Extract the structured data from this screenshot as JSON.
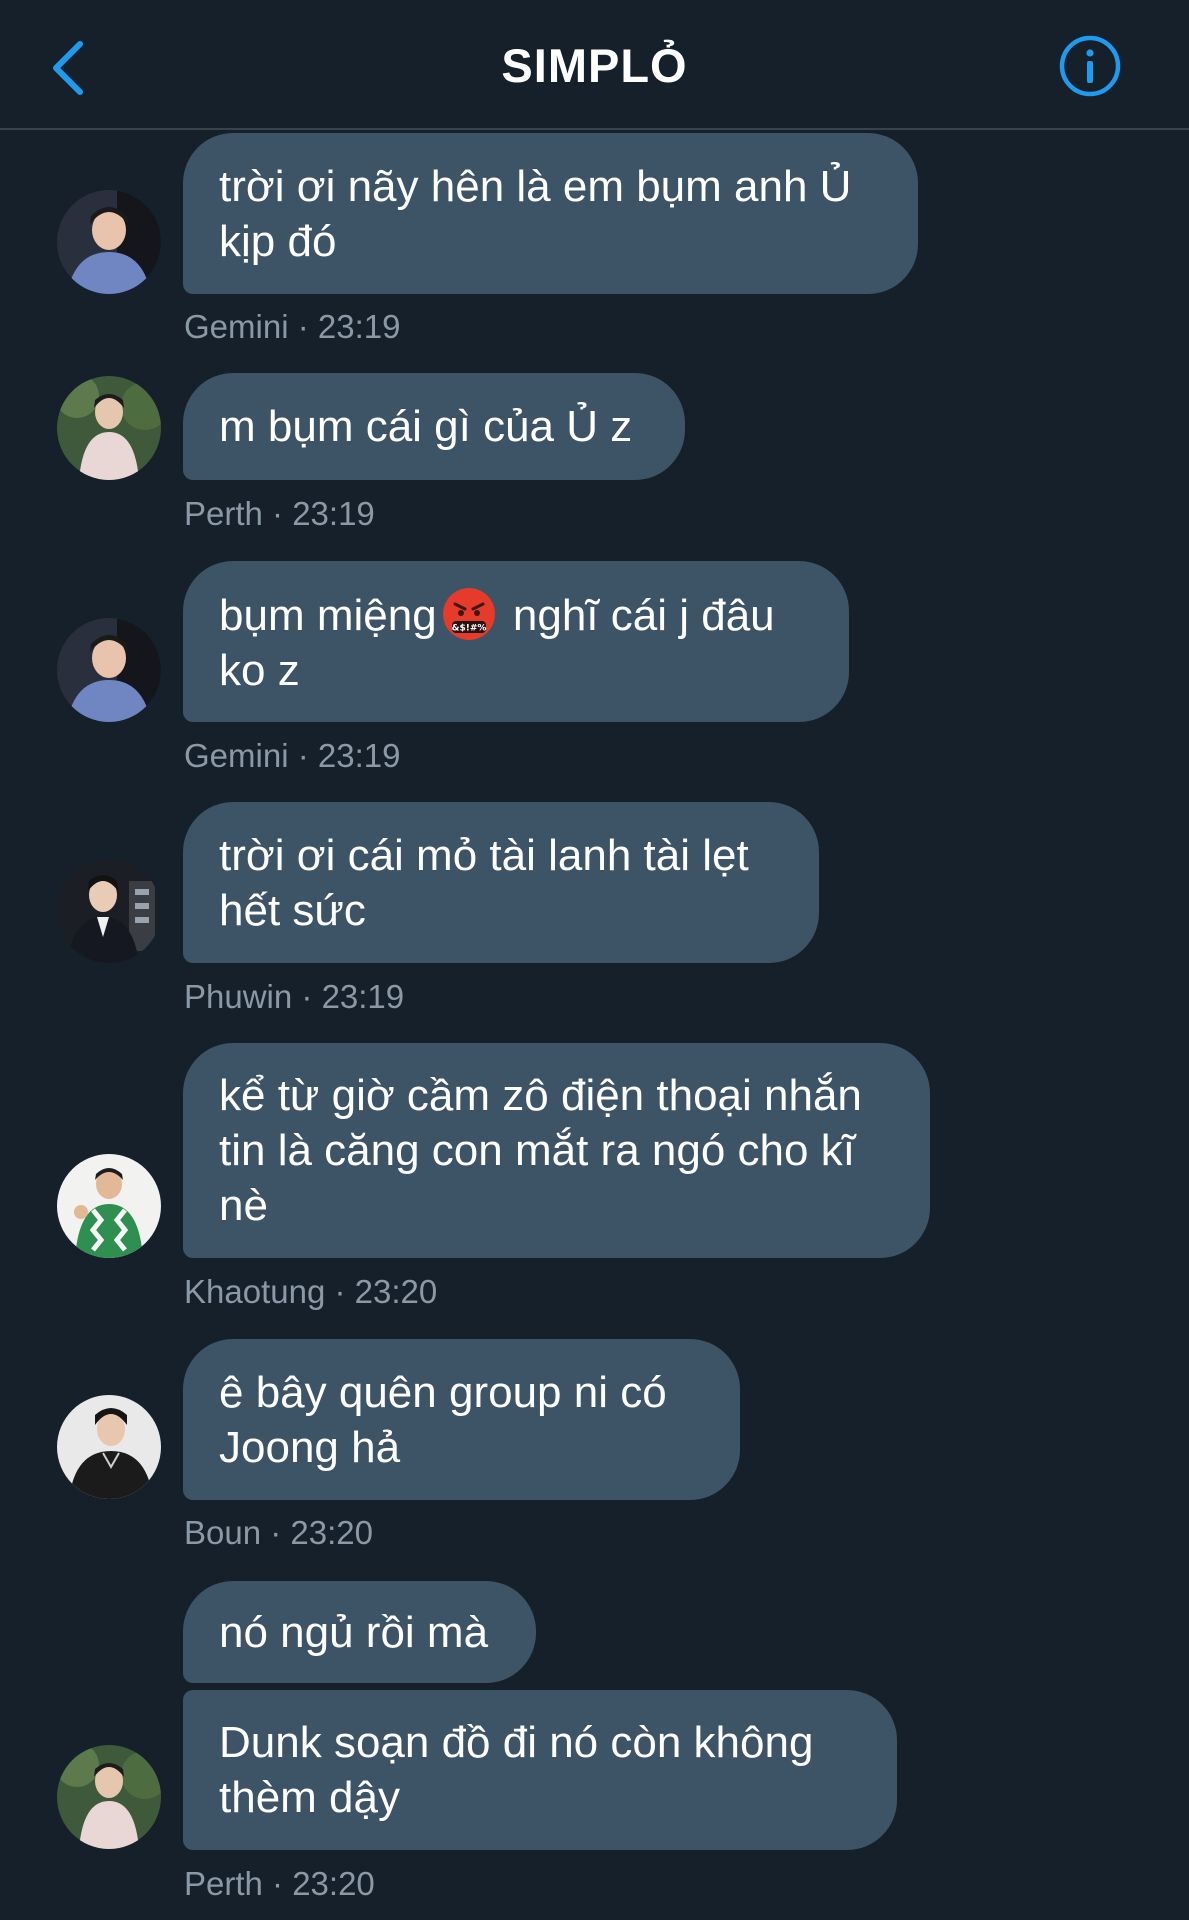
{
  "header": {
    "title": "SIMPLỎ",
    "accent": "#1d9bf0"
  },
  "messages": [
    {
      "text": "trời ơi nãy hên là em bụm anh Ủ kịp đó",
      "sender": "Gemini",
      "time": "23:19"
    },
    {
      "text": "m bụm cái gì của Ủ z",
      "sender": "Perth",
      "time": "23:19"
    },
    {
      "text_before": "bụm miệng",
      "emoji": "face-with-symbols-on-mouth",
      "text_after": " nghĩ cái j đâu ko z",
      "sender": "Gemini",
      "time": "23:19"
    },
    {
      "text": "trời ơi cái mỏ tài lanh tài lẹt hết sức",
      "sender": "Phuwin",
      "time": "23:19"
    },
    {
      "text": "kể từ giờ cầm zô điện thoại nhắn tin là căng con mắt ra ngó cho kĩ nè",
      "sender": "Khaotung",
      "time": "23:20"
    },
    {
      "text": "ê bây quên group ni có Joong hả",
      "sender": "Boun",
      "time": "23:20"
    },
    {
      "text": "nó ngủ rồi mà",
      "sender": "Perth",
      "time": ""
    },
    {
      "text": "Dunk soạn đồ đi nó còn không thèm dậy",
      "sender": "Perth",
      "time": "23:20"
    }
  ],
  "meta": {
    "separator": " · "
  },
  "colors": {
    "background": "#15202b",
    "bubble": "#3d5366",
    "meta_text": "#8b98a5",
    "divider": "#38444d"
  }
}
